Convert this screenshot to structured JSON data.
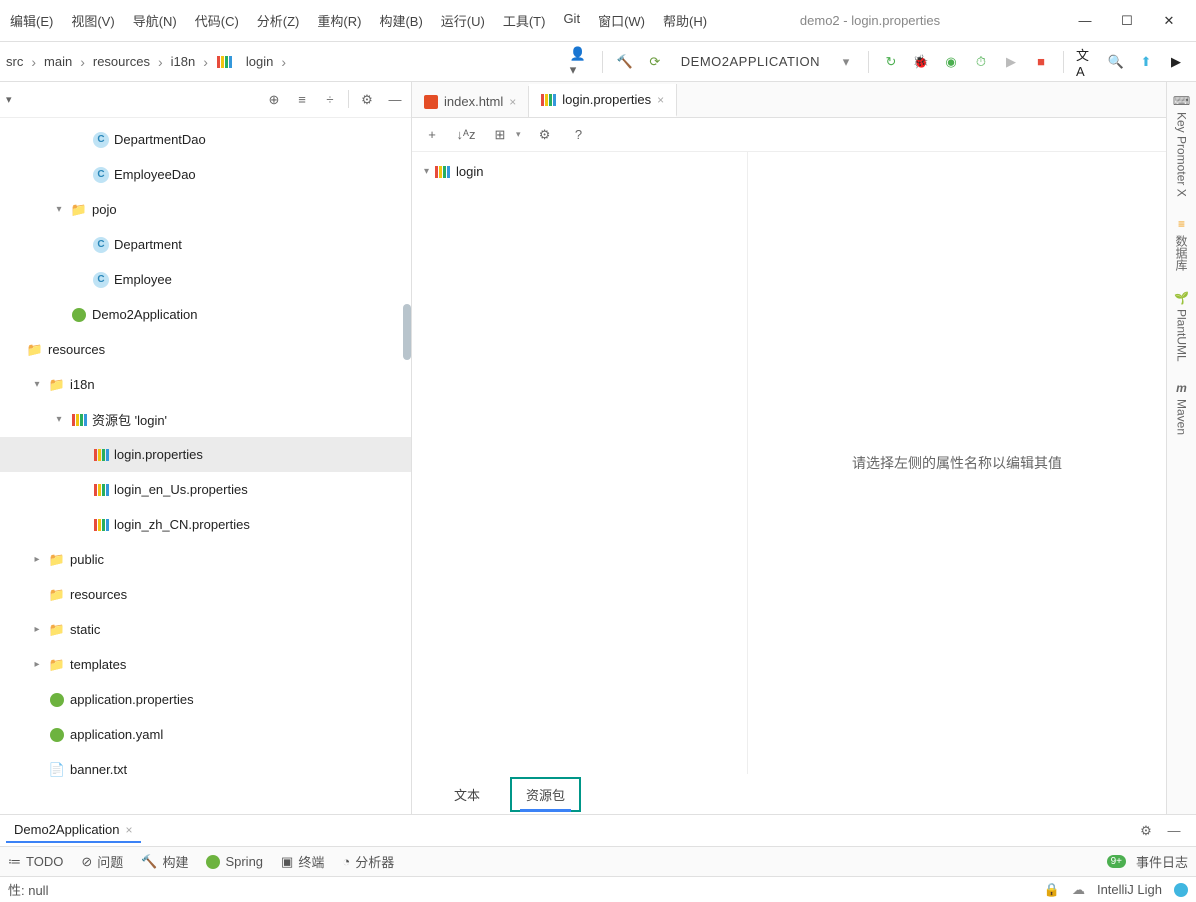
{
  "window": {
    "title": "demo2 - login.properties"
  },
  "menu": {
    "items": [
      "编辑(E)",
      "视图(V)",
      "导航(N)",
      "代码(C)",
      "分析(Z)",
      "重构(R)",
      "构建(B)",
      "运行(U)",
      "工具(T)",
      "Git",
      "窗口(W)",
      "帮助(H)"
    ]
  },
  "breadcrumb": {
    "items": [
      "src",
      "main",
      "resources",
      "i18n",
      "login"
    ]
  },
  "runconfig": {
    "name": "DEMO2APPLICATION"
  },
  "tree": {
    "items": [
      {
        "indent": 3,
        "arrow": "",
        "icon": "class",
        "label": "DepartmentDao"
      },
      {
        "indent": 3,
        "arrow": "",
        "icon": "class",
        "label": "EmployeeDao"
      },
      {
        "indent": 2,
        "arrow": "down",
        "icon": "folder",
        "label": "pojo"
      },
      {
        "indent": 3,
        "arrow": "",
        "icon": "class",
        "label": "Department"
      },
      {
        "indent": 3,
        "arrow": "",
        "icon": "class",
        "label": "Employee"
      },
      {
        "indent": 2,
        "arrow": "",
        "icon": "spring",
        "label": "Demo2Application"
      },
      {
        "indent": 0,
        "arrow": "",
        "icon": "folder-res",
        "label": "resources"
      },
      {
        "indent": 1,
        "arrow": "down",
        "icon": "folder",
        "label": "i18n"
      },
      {
        "indent": 2,
        "arrow": "down",
        "icon": "bundle",
        "label": "资源包 'login'"
      },
      {
        "indent": 3,
        "arrow": "",
        "icon": "props",
        "label": "login.properties",
        "selected": true
      },
      {
        "indent": 3,
        "arrow": "",
        "icon": "props",
        "label": "login_en_Us.properties"
      },
      {
        "indent": 3,
        "arrow": "",
        "icon": "props",
        "label": "login_zh_CN.properties"
      },
      {
        "indent": 1,
        "arrow": "right",
        "icon": "folder",
        "label": "public"
      },
      {
        "indent": 1,
        "arrow": "",
        "icon": "folder",
        "label": "resources"
      },
      {
        "indent": 1,
        "arrow": "right",
        "icon": "folder",
        "label": "static"
      },
      {
        "indent": 1,
        "arrow": "right",
        "icon": "folder",
        "label": "templates"
      },
      {
        "indent": 1,
        "arrow": "",
        "icon": "spring-file",
        "label": "application.properties"
      },
      {
        "indent": 1,
        "arrow": "",
        "icon": "spring-file",
        "label": "application.yaml"
      },
      {
        "indent": 1,
        "arrow": "",
        "icon": "txt",
        "label": "banner.txt"
      }
    ]
  },
  "editor": {
    "tabs": [
      {
        "icon": "html",
        "label": "index.html",
        "active": false
      },
      {
        "icon": "props",
        "label": "login.properties",
        "active": true
      }
    ],
    "treeRoot": "login",
    "placeholder": "请选择左侧的属性名称以编辑其值",
    "bottomTabs": {
      "text": "文本",
      "bundle": "资源包"
    }
  },
  "runpanel": {
    "tab": "Demo2Application"
  },
  "bottombar": {
    "items": [
      "TODO",
      "问题",
      "构建",
      "Spring",
      "终端",
      "分析器"
    ],
    "eventlog": "事件日志",
    "badge": "9+"
  },
  "statusbar": {
    "left": "性: null",
    "right": "IntelliJ Ligh"
  },
  "rightbar": {
    "items": [
      "Key Promoter X",
      "数据库",
      "PlantUML",
      "Maven"
    ]
  }
}
